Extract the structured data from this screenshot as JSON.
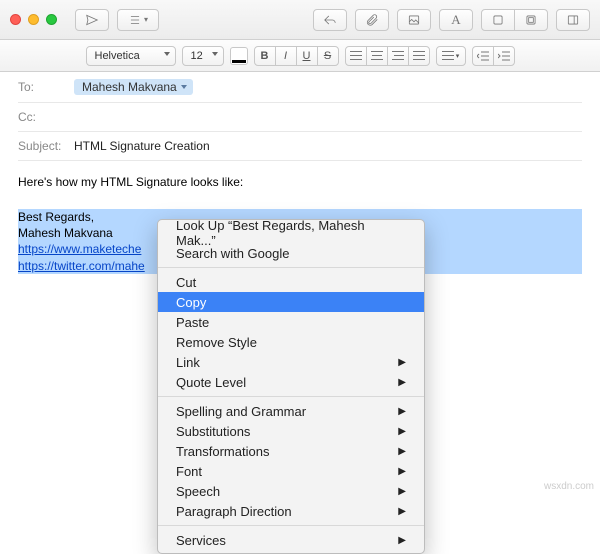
{
  "titlebar": {
    "buttons": {
      "send": "send",
      "header_menu": "header-menu",
      "reply": "reply",
      "attach": "attach",
      "photo": "photo",
      "format": "format",
      "emoji": "emoji",
      "sidebar": "sidebar"
    }
  },
  "formatbar": {
    "font": "Helvetica",
    "size": "12",
    "bold": "B",
    "italic": "I",
    "underline": "U",
    "strike": "S",
    "indent_less": "‹",
    "indent_more": "›"
  },
  "headers": {
    "to_label": "To:",
    "to_value": "Mahesh Makvana",
    "cc_label": "Cc:",
    "subject_label": "Subject:",
    "subject_value": "HTML Signature Creation"
  },
  "body": {
    "intro": "Here's how my HTML Signature looks like:",
    "sig_line1": "Best Regards,",
    "sig_line2": "Mahesh Makvana",
    "sig_link1": "https://www.maketeche",
    "sig_link2": "https://twitter.com/mahe"
  },
  "context_menu": {
    "lookup": "Look Up “Best Regards, Mahesh Mak...”",
    "search_google": "Search with Google",
    "cut": "Cut",
    "copy": "Copy",
    "paste": "Paste",
    "remove_style": "Remove Style",
    "link": "Link",
    "quote_level": "Quote Level",
    "spelling": "Spelling and Grammar",
    "substitutions": "Substitutions",
    "transformations": "Transformations",
    "font": "Font",
    "speech": "Speech",
    "paragraph_direction": "Paragraph Direction",
    "services": "Services"
  },
  "watermark": "wsxdn.com"
}
